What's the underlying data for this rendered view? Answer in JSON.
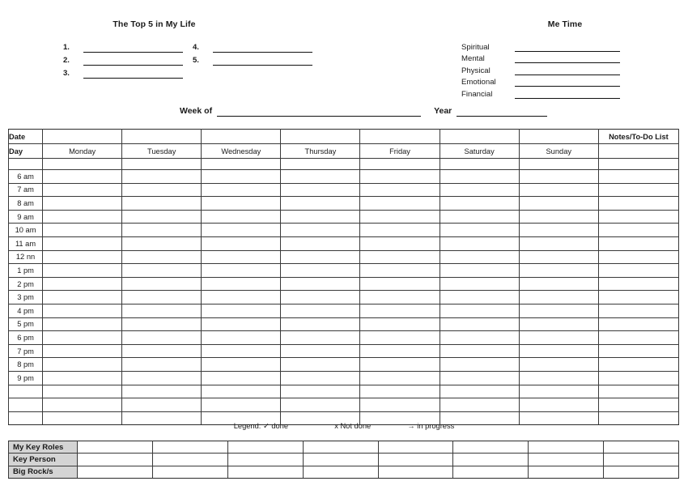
{
  "top5": {
    "title": "The Top 5 in My Life",
    "left_items": [
      "1.",
      "2.",
      "3."
    ],
    "right_items": [
      "4.",
      "5."
    ]
  },
  "me_time": {
    "title": "Me Time",
    "labels": [
      "Spiritual",
      "Mental",
      "Physical",
      "Emotional",
      "Financial"
    ]
  },
  "week_line": {
    "week_label": "Week of",
    "year_label": "Year"
  },
  "schedule": {
    "date_label": "Date",
    "day_label": "Day",
    "notes_header": "Notes/To-Do List",
    "days": [
      "Monday",
      "Tuesday",
      "Wednesday",
      "Thursday",
      "Friday",
      "Saturday",
      "Sunday"
    ],
    "times": [
      "6 am",
      "7 am",
      "8 am",
      "9 am",
      "10 am",
      "11 am",
      "12 nn",
      "1 pm",
      "2 pm",
      "3 pm",
      "4 pm",
      "5 pm",
      "6 pm",
      "7 pm",
      "8 pm",
      "9 pm"
    ],
    "blank_rows_after": 3,
    "notes_fill_color": "#d4d4d4"
  },
  "legend": {
    "prefix": "Legend:",
    "done_symbol": "✓",
    "done_text": "done",
    "notdone_symbol": "x",
    "notdone_text": "Not done",
    "inprogress_symbol": "→",
    "inprogress_text": "in progress"
  },
  "bottom": {
    "rows": [
      "My Key Roles",
      "Key Person",
      "Big Rock/s"
    ],
    "columns": 8
  }
}
